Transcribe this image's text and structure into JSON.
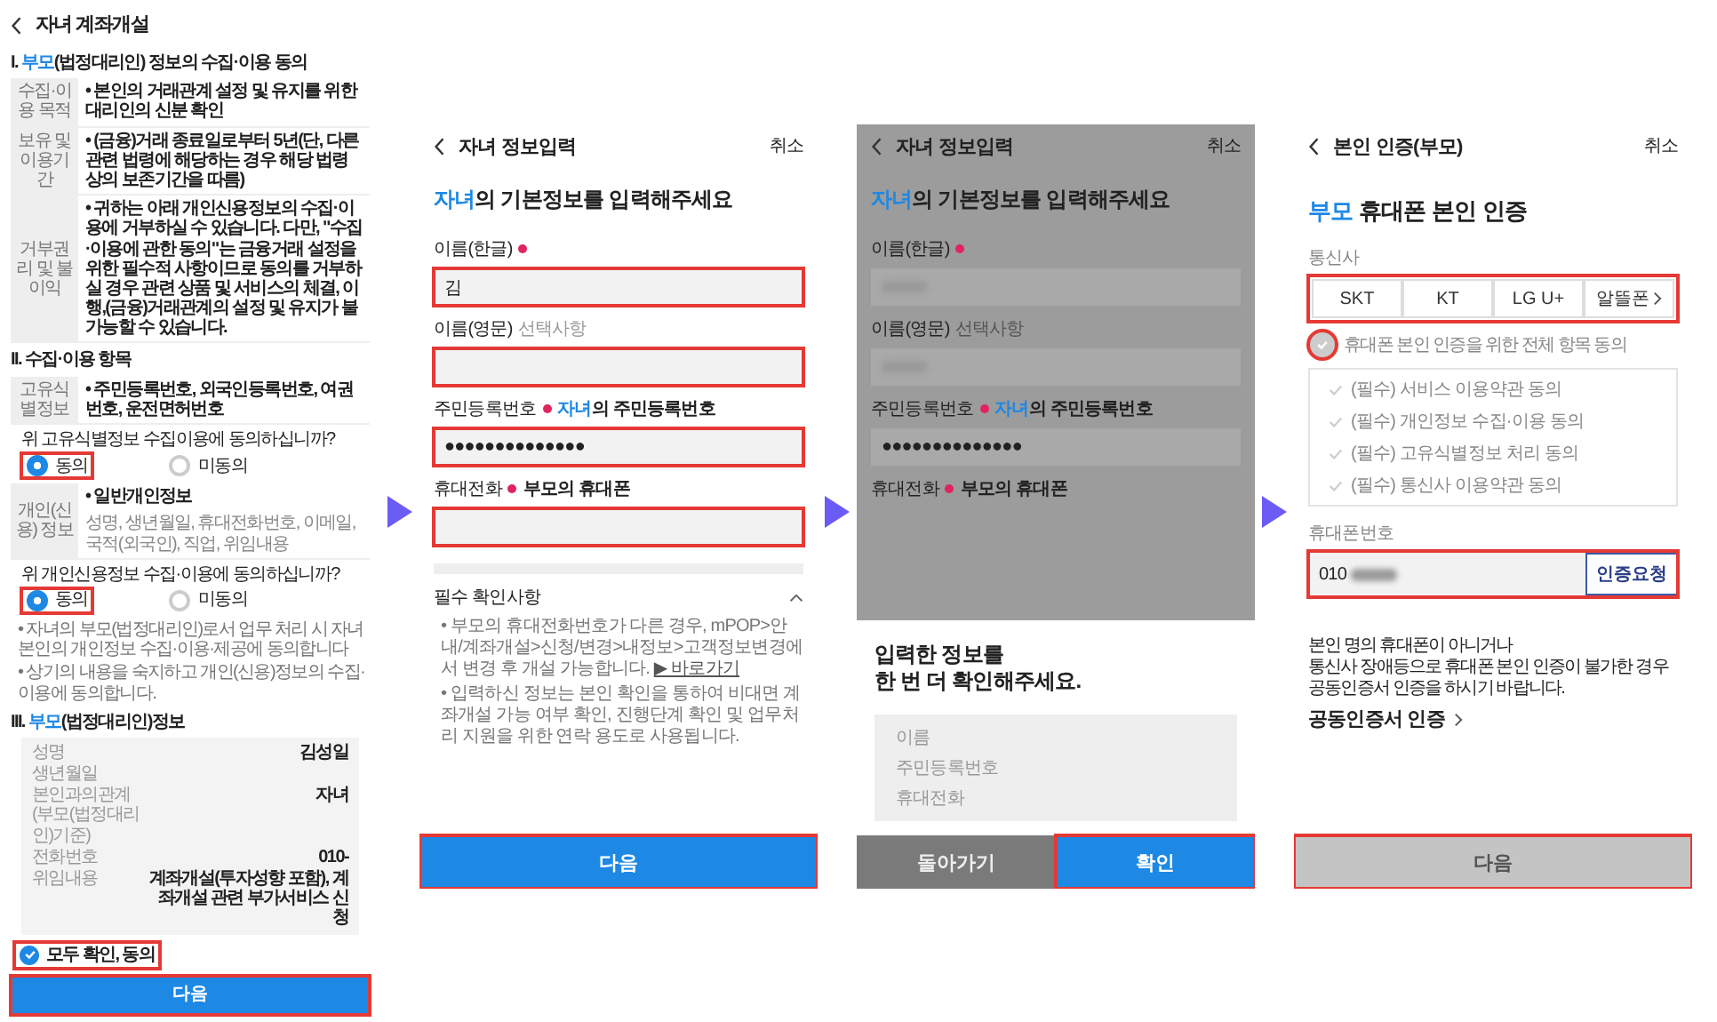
{
  "consent_screen": {
    "title": "자녀 계좌개설",
    "section_1": {
      "prefix": "I.",
      "accent": "부모",
      "rest": "(법정대리인) 정보의 수집·이용 동의"
    },
    "terms_rows": [
      {
        "label": "수집·이용 목적",
        "text": "• 본인의 거래관계 설정 및 유지를 위한 대리인의 신분 확인"
      },
      {
        "label": "보유 및 이용기간",
        "text": "• (금융)거래 종료일로부터 5년(단, 다른 관련 법령에 해당하는 경우 해당 법령상의 보존기간을 따름)"
      },
      {
        "label": "거부권리 및 불이익",
        "text": "• 귀하는 아래 개인신용정보의 수집·이용에 거부하실 수 있습니다. 다만, \"수집·이용에 관한 동의\"는 금융거래 설정을 위한 필수적 사항이므로 동의를 거부하실 경우 관련 상품 및 서비스의 체결, 이행,(금융)거래관계의 설정 및 유지가 불가능할 수 있습니다."
      }
    ],
    "section_2": {
      "prefix": "II.",
      "rest": "수집·이용 항목"
    },
    "unique_row": {
      "label": "고유식별정보",
      "text": "• 주민등록번호, 외국인등록번호, 여권번호, 운전면허번호"
    },
    "question_1": "위 고유식별정보 수집이용에 동의하십니까?",
    "options_1": [
      {
        "label": "동의",
        "selected": true,
        "highlight": true
      },
      {
        "label": "미동의",
        "selected": false,
        "highlight": false
      }
    ],
    "personal_row": {
      "label": "개인(신용) 정보",
      "title": "• 일반개인정보",
      "text": "성명, 생년월일, 휴대전화번호, 이메일, 국적(외국인), 직업, 위임내용"
    },
    "question_2": "위 개인신용정보 수집·이용에 동의하십니까?",
    "options_2": [
      {
        "label": "동의",
        "selected": true,
        "highlight": true
      },
      {
        "label": "미동의",
        "selected": false,
        "highlight": false
      }
    ],
    "notes": [
      "• 자녀의 부모(법정대리인)로서 업무 처리 시 자녀 본인의 개인정보 수집·이용·제공에 동의합니다",
      "• 상기의 내용을 숙지하고 개인(신용)정보의 수집·이용에 동의합니다."
    ],
    "section_3": {
      "prefix": "III.",
      "accent": "부모",
      "rest": "(법정대리인)정보"
    },
    "info": [
      {
        "label": "성명",
        "value": "김성일"
      },
      {
        "label": "생년월일"
      },
      {
        "label": "본인과의관계 (부모(법정대리인)기준)",
        "value": "자녀"
      },
      {
        "label": "전화번호",
        "value": "010-"
      },
      {
        "label": "위임내용",
        "value": "계좌개설(투자성향 포함), 계좌개설 관련 부가서비스 신청"
      }
    ],
    "agree_all": {
      "label": "모두 확인, 동의",
      "checked": true,
      "highlight": true
    },
    "next_button": {
      "label": "다음",
      "highlight": true
    }
  },
  "child_info_screen": {
    "title": "자녀 정보입력",
    "cancel": "취소",
    "heading_accent": "자녀",
    "heading_rest": "의 기본정보를 입력해주세요",
    "fields": [
      {
        "kind": "text",
        "label": "이름(한글)",
        "required": true,
        "value": "김",
        "highlight": true
      },
      {
        "kind": "text",
        "label": "이름(영문)",
        "required": false,
        "note": "선택사항",
        "note_bold": false,
        "highlight": true
      },
      {
        "kind": "text",
        "label": "주민등록번호",
        "required": true,
        "note_accent": "자녀",
        "note": "의 주민등록번호",
        "note_bold": true,
        "value": "●●●●●●●●●●●●●●",
        "highlight": true
      },
      {
        "kind": "text",
        "label": "휴대전화",
        "required": true,
        "note": "부모의 휴대폰",
        "note_bold": true,
        "highlight": true
      }
    ],
    "notice": {
      "title": "필수 확인사항",
      "expanded": true,
      "items": [
        "• 부모의 휴대전화번호가 다른 경우, mPOP>안내/계좌개설>신청/변경>내정보>고객정보변경에서 변경 후 개설 가능합니다.",
        "• 입력하신 정보는 본인 확인을 통하여 비대면 계좌개설 가능 여부 확인, 진행단계 확인 및 업무처리 지원을 위한 연락 용도로 사용됩니다."
      ],
      "link": "▶ 바로가기"
    },
    "next_button": {
      "label": "다음",
      "highlight": true
    }
  },
  "confirm_screen": {
    "title": "자녀 정보입력",
    "cancel": "취소",
    "heading_accent": "자녀",
    "heading_rest": "의 기본정보를 입력해주세요",
    "fields": [
      {
        "kind": "text",
        "label": "이름(한글)",
        "required": true,
        "redacted": true
      },
      {
        "kind": "text",
        "label": "이름(영문)",
        "required": false,
        "note": "선택사항",
        "note_bold": false,
        "redacted": true
      },
      {
        "kind": "text",
        "label": "주민등록번호",
        "required": true,
        "note_accent": "자녀",
        "note": "의 주민등록번호",
        "note_bold": true,
        "value": "●●●●●●●●●●●●●●"
      },
      {
        "kind": "label_only",
        "label": "휴대전화",
        "required": true,
        "note": "부모의 휴대폰",
        "note_bold": true
      }
    ],
    "dialog": {
      "title": "입력한 정보를\n한 번 더 확인해주세요.",
      "items": [
        "이름",
        "주민등록번호",
        "휴대전화"
      ],
      "back_button": "돌아가기",
      "confirm_button": {
        "label": "확인",
        "highlight": true
      }
    }
  },
  "verify_screen": {
    "title": "본인 인증(부모)",
    "cancel": "취소",
    "heading_accent": "부모",
    "heading_rest": " 휴대폰 본인 인증",
    "carrier_label": "통신사",
    "carriers_highlight": true,
    "carriers": [
      {
        "label": "SKT",
        "selected": false,
        "more": false
      },
      {
        "label": "KT",
        "selected": false,
        "more": false
      },
      {
        "label": "LG U+",
        "selected": false,
        "more": false
      },
      {
        "label": "알뜰폰",
        "selected": false,
        "more": true
      }
    ],
    "agree_all": {
      "label": "휴대폰 본인 인증을 위한 전체 항목 동의",
      "checked": false,
      "highlight": true
    },
    "terms": [
      {
        "label": "(필수) 서비스 이용약관 동의",
        "checked": false
      },
      {
        "label": "(필수) 개인정보 수집·이용 동의",
        "checked": false
      },
      {
        "label": "(필수) 고유식별정보 처리 동의",
        "checked": false
      },
      {
        "label": "(필수) 통신사 이용약관 동의",
        "checked": false
      }
    ],
    "phone": {
      "label": "휴대폰번호",
      "value": "010",
      "redacted": true,
      "button": "인증요청",
      "highlight": true
    },
    "note": "본인 명의 휴대폰이 아니거나\n통신사 장애등으로 휴대폰 본인 인증이 불가한 경우\n공동인증서 인증을 하시기 바랍니다.",
    "link": "공동인증서 인증",
    "next_button": {
      "label": "다음",
      "disabled": true,
      "highlight": true
    }
  }
}
